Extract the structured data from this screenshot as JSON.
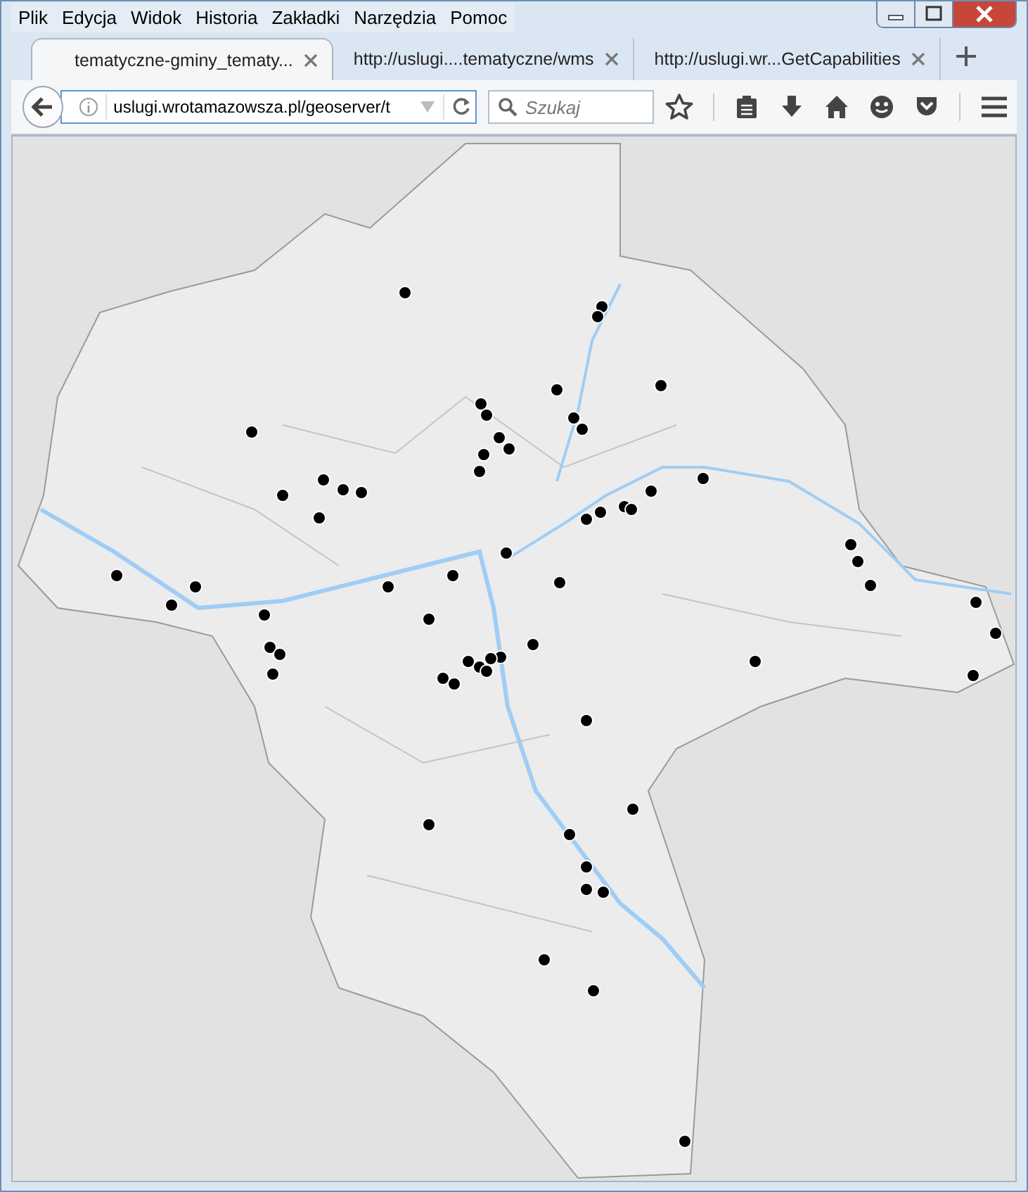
{
  "menu": [
    "Plik",
    "Edycja",
    "Widok",
    "Historia",
    "Zakładki",
    "Narzędzia",
    "Pomoc"
  ],
  "tabs": [
    {
      "label": "tematyczne-gminy_tematy...",
      "selected": true
    },
    {
      "label": "http://uslugi....tematyczne/wms",
      "selected": false
    },
    {
      "label": "http://uslugi.wr...GetCapabilities",
      "selected": false
    }
  ],
  "address": {
    "value": "uslugi.wrotamazowsza.pl/geoserver/t"
  },
  "search": {
    "placeholder": "Szukaj"
  }
}
